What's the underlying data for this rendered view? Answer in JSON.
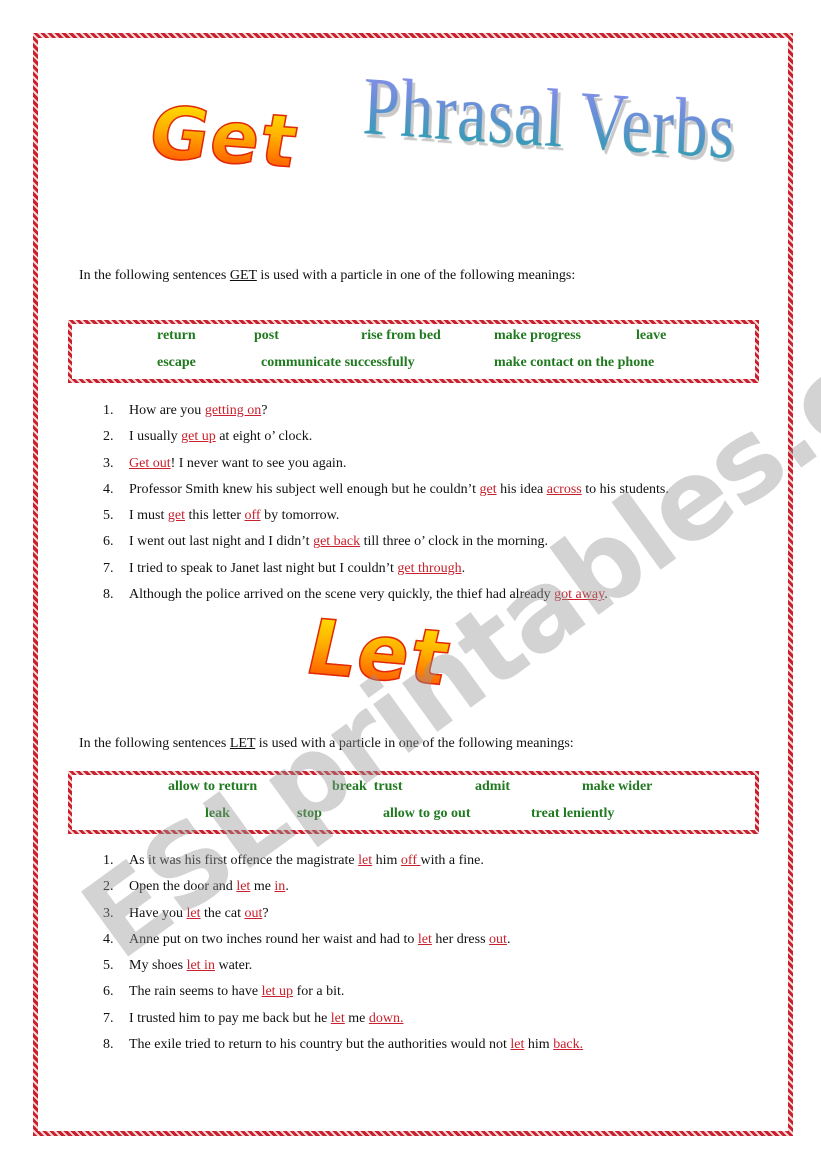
{
  "document": {
    "title_word_get": "Get",
    "title_heading": "Phrasal Verbs",
    "title_word_let": "Let",
    "watermark": "ESLprintables.com",
    "accent_color": "#c8202c",
    "meaning_color": "#1f7a1f"
  },
  "get_section": {
    "intro_before": "In the following sentences ",
    "intro_verb": "GET",
    "intro_after": " is used with a particle in one of the following meanings:",
    "meanings_row1": [
      "return",
      "post",
      "rise from bed",
      "make progress",
      "leave"
    ],
    "meanings_row2": [
      "escape",
      "communicate successfully",
      "make contact on the phone"
    ],
    "sentences": [
      {
        "num": "1.",
        "parts": [
          {
            "t": "How are you "
          },
          {
            "t": "getting on",
            "pv": true
          },
          {
            "t": "?"
          }
        ]
      },
      {
        "num": "2.",
        "parts": [
          {
            "t": "I usually "
          },
          {
            "t": "get up",
            "pv": true
          },
          {
            "t": " at eight o’ clock."
          }
        ]
      },
      {
        "num": "3.",
        "parts": [
          {
            "t": "Get out",
            "pv": true
          },
          {
            "t": "! I never want to see you again."
          }
        ]
      },
      {
        "num": "4.",
        "parts": [
          {
            "t": "Professor Smith knew his subject well enough but he couldn’t "
          },
          {
            "t": "get",
            "pv": true
          },
          {
            "t": " his idea "
          },
          {
            "t": "across",
            "pv": true
          },
          {
            "t": " to his students."
          }
        ]
      },
      {
        "num": "5.",
        "parts": [
          {
            "t": "I must "
          },
          {
            "t": "get",
            "pv": true
          },
          {
            "t": " this letter "
          },
          {
            "t": "off",
            "pv": true
          },
          {
            "t": " by tomorrow."
          }
        ]
      },
      {
        "num": "6.",
        "parts": [
          {
            "t": "I went out last night and I didn’t "
          },
          {
            "t": "get back",
            "pv": true
          },
          {
            "t": " till three o’ clock in the morning."
          }
        ]
      },
      {
        "num": "7.",
        "parts": [
          {
            "t": "I tried to speak to Janet last night but I couldn’t "
          },
          {
            "t": "get through",
            "pv": true
          },
          {
            "t": "."
          }
        ]
      },
      {
        "num": "8.",
        "parts": [
          {
            "t": "Although the police arrived on the scene very quickly, the thief had already "
          },
          {
            "t": "got away",
            "pv": true
          },
          {
            "t": "."
          }
        ]
      }
    ]
  },
  "let_section": {
    "intro_before": "In the following sentences ",
    "intro_verb": "LET",
    "intro_after": " is used with a particle in one of the following meanings:",
    "meanings_row1": [
      "allow to return",
      "break  trust",
      "admit",
      "make wider"
    ],
    "meanings_row2": [
      "leak",
      "stop",
      "allow to go out",
      "treat leniently"
    ],
    "sentences": [
      {
        "num": "1.",
        "parts": [
          {
            "t": "As it was his first offence the magistrate "
          },
          {
            "t": "let",
            "pv": true
          },
          {
            "t": " him "
          },
          {
            "t": "off ",
            "pv": true
          },
          {
            "t": "with a fine."
          }
        ]
      },
      {
        "num": "2.",
        "parts": [
          {
            "t": "Open the door and "
          },
          {
            "t": "let",
            "pv": true
          },
          {
            "t": " me "
          },
          {
            "t": "in",
            "pv": true
          },
          {
            "t": "."
          }
        ]
      },
      {
        "num": "3.",
        "parts": [
          {
            "t": "Have you "
          },
          {
            "t": "let",
            "pv": true
          },
          {
            "t": " the cat "
          },
          {
            "t": "out",
            "pv": true
          },
          {
            "t": "?"
          }
        ]
      },
      {
        "num": "4.",
        "parts": [
          {
            "t": "Anne put on two inches round her waist and had to "
          },
          {
            "t": "let",
            "pv": true
          },
          {
            "t": " her dress "
          },
          {
            "t": "out",
            "pv": true
          },
          {
            "t": "."
          }
        ]
      },
      {
        "num": "5.",
        "parts": [
          {
            "t": "My shoes "
          },
          {
            "t": "let in",
            "pv": true
          },
          {
            "t": " water."
          }
        ]
      },
      {
        "num": "6.",
        "parts": [
          {
            "t": "The rain seems to have "
          },
          {
            "t": "let up",
            "pv": true
          },
          {
            "t": " for a bit."
          }
        ]
      },
      {
        "num": "7.",
        "parts": [
          {
            "t": "I trusted him to pay me back but he "
          },
          {
            "t": "let",
            "pv": true
          },
          {
            "t": " me "
          },
          {
            "t": "down.",
            "pv": true
          }
        ]
      },
      {
        "num": "8.",
        "parts": [
          {
            "t": "The exile tried to return to his country but the authorities would not "
          },
          {
            "t": "let",
            "pv": true
          },
          {
            "t": " him "
          },
          {
            "t": "back.",
            "pv": true
          }
        ]
      }
    ]
  }
}
